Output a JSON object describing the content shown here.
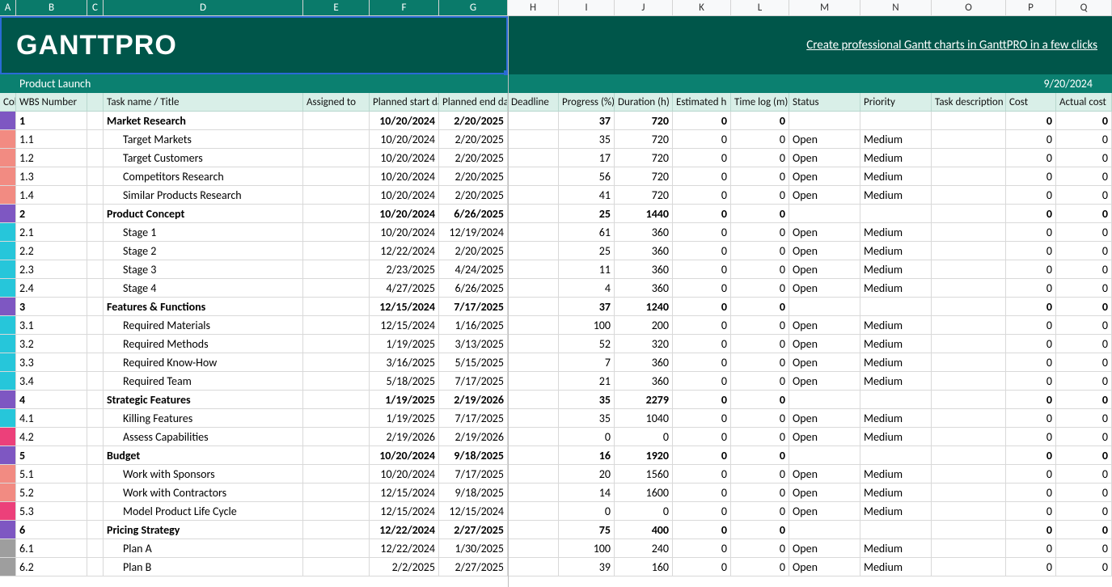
{
  "columns": [
    "A",
    "B",
    "C",
    "D",
    "E",
    "F",
    "G",
    "H",
    "I",
    "J",
    "K",
    "L",
    "M",
    "N",
    "O",
    "P",
    "Q"
  ],
  "selected_columns": [
    "A",
    "B",
    "C",
    "D",
    "E",
    "F",
    "G"
  ],
  "logo_text": "GANTTPRO",
  "brand_link": "Create professional Gantt charts in GanttPRO in a few clicks",
  "project_title": "Product Launch",
  "report_date": "9/20/2024",
  "headers": {
    "A": "Color",
    "B": "WBS Number",
    "D": "Task name / Title",
    "E": "Assigned to",
    "F": "Planned start date",
    "G": "Planned end date",
    "H": "Deadline",
    "I": "Progress (%)",
    "J": "Duration  (h)",
    "K": "Estimated h",
    "L": "Time log (m)",
    "M": "Status",
    "N": "Priority",
    "O": "Task description",
    "P": "Cost",
    "Q": "Actual cost"
  },
  "rows": [
    {
      "color": "#7e57c2",
      "wbs": "1",
      "title": "Market Research",
      "bold": true,
      "start": "10/20/2024",
      "end": "2/20/2025",
      "progress": 37,
      "duration": 720,
      "est": 0,
      "time": 0,
      "status": "",
      "priority": "",
      "cost": 0,
      "actual": 0
    },
    {
      "color": "#f28b82",
      "wbs": "1.1",
      "title": "Target Markets",
      "indent": 1,
      "start": "10/20/2024",
      "end": "2/20/2025",
      "progress": 35,
      "duration": 720,
      "est": 0,
      "time": 0,
      "status": "Open",
      "priority": "Medium",
      "cost": 0,
      "actual": 0
    },
    {
      "color": "#f28b82",
      "wbs": "1.2",
      "title": "Target Customers",
      "indent": 1,
      "start": "10/20/2024",
      "end": "2/20/2025",
      "progress": 17,
      "duration": 720,
      "est": 0,
      "time": 0,
      "status": "Open",
      "priority": "Medium",
      "cost": 0,
      "actual": 0
    },
    {
      "color": "#f28b82",
      "wbs": "1.3",
      "title": "Competitors Research",
      "indent": 1,
      "start": "10/20/2024",
      "end": "2/20/2025",
      "progress": 56,
      "duration": 720,
      "est": 0,
      "time": 0,
      "status": "Open",
      "priority": "Medium",
      "cost": 0,
      "actual": 0
    },
    {
      "color": "#f28b82",
      "wbs": "1.4",
      "title": "Similar Products Research",
      "indent": 1,
      "start": "10/20/2024",
      "end": "2/20/2025",
      "progress": 41,
      "duration": 720,
      "est": 0,
      "time": 0,
      "status": "Open",
      "priority": "Medium",
      "cost": 0,
      "actual": 0
    },
    {
      "color": "#7e57c2",
      "wbs": "2",
      "title": "Product Concept",
      "bold": true,
      "start": "10/20/2024",
      "end": "6/26/2025",
      "progress": 25,
      "duration": 1440,
      "est": 0,
      "time": 0,
      "status": "",
      "priority": "",
      "cost": 0,
      "actual": 0
    },
    {
      "color": "#26c6da",
      "wbs": "2.1",
      "title": "Stage 1",
      "indent": 1,
      "start": "10/20/2024",
      "end": "12/19/2024",
      "progress": 61,
      "duration": 360,
      "est": 0,
      "time": 0,
      "status": "Open",
      "priority": "Medium",
      "cost": 0,
      "actual": 0
    },
    {
      "color": "#26c6da",
      "wbs": "2.2",
      "title": "Stage 2",
      "indent": 1,
      "start": "12/22/2024",
      "end": "2/20/2025",
      "progress": 25,
      "duration": 360,
      "est": 0,
      "time": 0,
      "status": "Open",
      "priority": "Medium",
      "cost": 0,
      "actual": 0
    },
    {
      "color": "#26c6da",
      "wbs": "2.3",
      "title": "Stage 3",
      "indent": 1,
      "start": "2/23/2025",
      "end": "4/24/2025",
      "progress": 11,
      "duration": 360,
      "est": 0,
      "time": 0,
      "status": "Open",
      "priority": "Medium",
      "cost": 0,
      "actual": 0
    },
    {
      "color": "#26c6da",
      "wbs": "2.4",
      "title": "Stage 4",
      "indent": 1,
      "start": "4/27/2025",
      "end": "6/26/2025",
      "progress": 4,
      "duration": 360,
      "est": 0,
      "time": 0,
      "status": "Open",
      "priority": "Medium",
      "cost": 0,
      "actual": 0
    },
    {
      "color": "#7e57c2",
      "wbs": "3",
      "title": "Features & Functions",
      "bold": true,
      "start": "12/15/2024",
      "end": "7/17/2025",
      "progress": 37,
      "duration": 1240,
      "est": 0,
      "time": 0,
      "status": "",
      "priority": "",
      "cost": 0,
      "actual": 0
    },
    {
      "color": "#26c6da",
      "wbs": "3.1",
      "title": "Required Materials",
      "indent": 1,
      "start": "12/15/2024",
      "end": "1/16/2025",
      "progress": 100,
      "duration": 200,
      "est": 0,
      "time": 0,
      "status": "Open",
      "priority": "Medium",
      "cost": 0,
      "actual": 0
    },
    {
      "color": "#26c6da",
      "wbs": "3.2",
      "title": "Required Methods",
      "indent": 1,
      "start": "1/19/2025",
      "end": "3/13/2025",
      "progress": 52,
      "duration": 320,
      "est": 0,
      "time": 0,
      "status": "Open",
      "priority": "Medium",
      "cost": 0,
      "actual": 0
    },
    {
      "color": "#26c6da",
      "wbs": "3.3",
      "title": "Required Know-How",
      "indent": 1,
      "start": "3/16/2025",
      "end": "5/15/2025",
      "progress": 7,
      "duration": 360,
      "est": 0,
      "time": 0,
      "status": "Open",
      "priority": "Medium",
      "cost": 0,
      "actual": 0
    },
    {
      "color": "#26c6da",
      "wbs": "3.4",
      "title": "Required Team",
      "indent": 1,
      "start": "5/18/2025",
      "end": "7/17/2025",
      "progress": 21,
      "duration": 360,
      "est": 0,
      "time": 0,
      "status": "Open",
      "priority": "Medium",
      "cost": 0,
      "actual": 0
    },
    {
      "color": "#7e57c2",
      "wbs": "4",
      "title": "Strategic Features",
      "bold": true,
      "start": "1/19/2025",
      "end": "2/19/2026",
      "progress": 35,
      "duration": 2279,
      "est": 0,
      "time": 0,
      "status": "",
      "priority": "",
      "cost": 0,
      "actual": 0
    },
    {
      "color": "#26c6da",
      "wbs": "4.1",
      "title": "Killing Features",
      "indent": 1,
      "start": "1/19/2025",
      "end": "7/17/2025",
      "progress": 35,
      "duration": 1040,
      "est": 0,
      "time": 0,
      "status": "Open",
      "priority": "Medium",
      "cost": 0,
      "actual": 0
    },
    {
      "color": "#ec407a",
      "wbs": "4.2",
      "title": "Assess Capabilities",
      "indent": 1,
      "start": "2/19/2026",
      "end": "2/19/2026",
      "progress": 0,
      "duration": 0,
      "est": 0,
      "time": 0,
      "status": "Open",
      "priority": "Medium",
      "cost": 0,
      "actual": 0
    },
    {
      "color": "#7e57c2",
      "wbs": "5",
      "title": "Budget",
      "bold": true,
      "start": "10/20/2024",
      "end": "9/18/2025",
      "progress": 16,
      "duration": 1920,
      "est": 0,
      "time": 0,
      "status": "",
      "priority": "",
      "cost": 0,
      "actual": 0
    },
    {
      "color": "#f28b82",
      "wbs": "5.1",
      "title": "Work with Sponsors",
      "indent": 1,
      "start": "10/20/2024",
      "end": "7/17/2025",
      "progress": 20,
      "duration": 1560,
      "est": 0,
      "time": 0,
      "status": "Open",
      "priority": "Medium",
      "cost": 0,
      "actual": 0
    },
    {
      "color": "#f28b82",
      "wbs": "5.2",
      "title": "Work with Contractors",
      "indent": 1,
      "start": "12/15/2024",
      "end": "9/18/2025",
      "progress": 14,
      "duration": 1600,
      "est": 0,
      "time": 0,
      "status": "Open",
      "priority": "Medium",
      "cost": 0,
      "actual": 0
    },
    {
      "color": "#ec407a",
      "wbs": "5.3",
      "title": "Model Product Life Cycle",
      "indent": 1,
      "start": "12/15/2024",
      "end": "12/15/2024",
      "progress": 0,
      "duration": 0,
      "est": 0,
      "time": 0,
      "status": "Open",
      "priority": "Medium",
      "cost": 0,
      "actual": 0
    },
    {
      "color": "#7e57c2",
      "wbs": "6",
      "title": "Pricing Strategy",
      "bold": true,
      "start": "12/22/2024",
      "end": "2/27/2025",
      "progress": 75,
      "duration": 400,
      "est": 0,
      "time": 0,
      "status": "",
      "priority": "",
      "cost": 0,
      "actual": 0
    },
    {
      "color": "#9e9e9e",
      "wbs": "6.1",
      "title": "Plan A",
      "indent": 1,
      "start": "12/22/2024",
      "end": "1/30/2025",
      "progress": 100,
      "duration": 240,
      "est": 0,
      "time": 0,
      "status": "Open",
      "priority": "Medium",
      "cost": 0,
      "actual": 0
    },
    {
      "color": "#9e9e9e",
      "wbs": "6.2",
      "title": "Plan B",
      "indent": 1,
      "start": "2/2/2025",
      "end": "2/27/2025",
      "progress": 39,
      "duration": 160,
      "est": 0,
      "time": 0,
      "status": "Open",
      "priority": "Medium",
      "cost": 0,
      "actual": 0
    }
  ]
}
